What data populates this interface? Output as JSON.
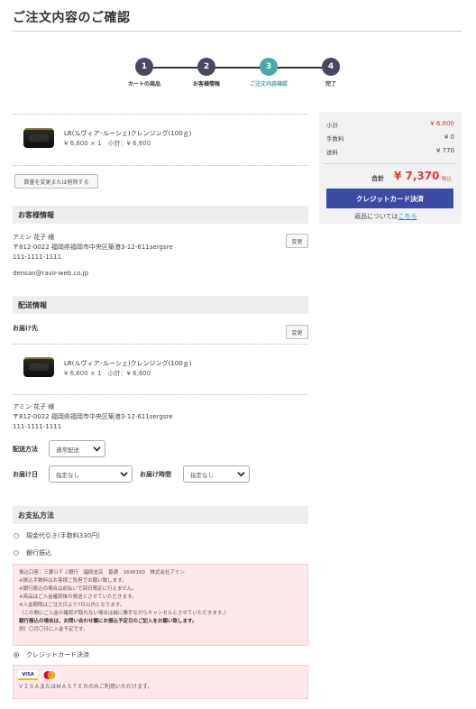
{
  "page": {
    "title": "ご注文内容のご確認"
  },
  "steps": [
    {
      "num": "1",
      "label": "カートの商品",
      "active": false
    },
    {
      "num": "2",
      "label": "お客様情報",
      "active": false
    },
    {
      "num": "3",
      "label": "ご注文内容確認",
      "active": true
    },
    {
      "num": "4",
      "label": "完了",
      "active": false
    }
  ],
  "cart": {
    "product_name": "LR(ルヴィア･ルーシェ)クレンジング(100ｇ)",
    "product_meta": "¥ 6,600 × 1　小計：¥ 6,600",
    "change_qty_label": "数量を変更または削除する"
  },
  "customer": {
    "heading": "お客様情報",
    "name": "アミン 花子 様",
    "address": "〒812-0022 福岡県福岡市中央区築港3-12-611sergsre",
    "phone": "111-1111-1111",
    "email": "densan@ravir-web.co.jp",
    "change_label": "変更"
  },
  "delivery": {
    "heading": "配送情報",
    "dest_label": "お届け先",
    "change_label": "変更",
    "product_name": "LR(ルヴィア･ルーシェ)クレンジング(100ｇ)",
    "product_meta": "¥ 6,600 × 1　小計：¥ 6,600",
    "name": "アミン 花子 様",
    "address": "〒812-0022 福岡県福岡市中央区築港3-12-611sergsre",
    "phone": "111-1111-1111",
    "method_label": "配送方法",
    "method_value": "通常配送",
    "date_label": "お届け日",
    "date_value": "指定なし",
    "time_label": "お届け時間",
    "time_value": "指定なし"
  },
  "payment": {
    "heading": "お支払方法",
    "options": [
      {
        "label": "現金代引き(手数料330円)",
        "checked": false
      },
      {
        "label": "銀行振込",
        "checked": false
      },
      {
        "label": "クレジットカード決済",
        "checked": true
      }
    ],
    "bank_lines": [
      "振込口座：三菱ＵＦＪ銀行　福岡支店　普通　1698160　株式会社アミン",
      "※振込手数料はお客様ご負担でお願い致します。",
      "※銀行振込の場合は前払いで回日限定に行えません。",
      "※商品はご入金確認後の発送とさせていただきます。",
      "※入金期限はご注文日より7日以内となります。",
      "（この間にご入金の確認が取れない場合は誠に勝手ながらキャンセルとさせていただきます。）"
    ],
    "bank_bold": "銀行振込の場合は、お問い合わせ欄にお振込予定日のご記入をお願い致します。",
    "bank_example": "例）〇月〇日に入金予定です。",
    "card_note": "ＶＩＳＡまたはＭＡＳＴＥＲのみご利用いただけます。",
    "card_visa": "VISA",
    "card_master": "MasterCard"
  },
  "summary": {
    "subtotal_label": "小計",
    "subtotal_value": "¥ 6,600",
    "fee_label": "手数料",
    "fee_value": "¥ 0",
    "shipping_label": "送料",
    "shipping_value": "¥ 770",
    "total_label": "合計",
    "total_value": "¥ 7,370",
    "total_tax": "税込",
    "pay_button": "クレジットカード決済",
    "returns_text": "返品については",
    "returns_link": "こちら"
  },
  "colors": {
    "accent": "#4aa9a5",
    "step": "#474a5e",
    "price": "#e03b3b",
    "button": "#3b4ba4"
  }
}
